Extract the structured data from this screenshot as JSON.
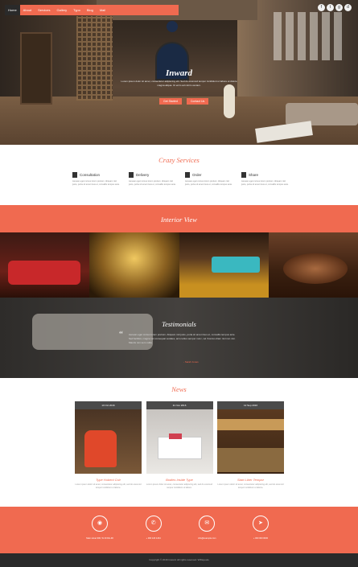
{
  "nav": {
    "items": [
      "Home",
      "About",
      "Services",
      "Gallery",
      "Typo",
      "Blog",
      "Mail"
    ],
    "active_index": 0
  },
  "social": [
    "facebook-icon",
    "twitter-icon",
    "google-plus-icon",
    "dribbble-icon"
  ],
  "hero": {
    "title": "Inward",
    "text": "Lorem ipsum dolor sit amet, consectetur adipiscing elit. Sed do eiusmod tempor incididunt ut labore et dolore magna aliqua. Ut enim ad minim veniam.",
    "btn_primary": "Get Started",
    "btn_secondary": "Contact Us"
  },
  "services": {
    "title": "Crazy Services",
    "items": [
      {
        "icon": "user-icon",
        "label": "Consultation",
        "text": "Aenean eget cursus lorem pretium. Aliquam nisl justo, porta sit amet risus et, convallis tempus ante."
      },
      {
        "icon": "bag-icon",
        "label": "Delivery",
        "text": "Aenean eget cursus lorem pretium. Aliquam nisl justo, porta sit amet risus et, convallis tempus ante."
      },
      {
        "icon": "document-icon",
        "label": "Order",
        "text": "Aenean eget cursus lorem pretium. Aliquam nisl justo, porta sit amet risus et, convallis tempus ante."
      },
      {
        "icon": "link-icon",
        "label": "Share",
        "text": "Aenean eget cursus lorem pretium. Aliquam nisl justo, porta sit amet risus et, convallis tempus ante."
      }
    ]
  },
  "interior": {
    "title": "Interior View"
  },
  "testimonials": {
    "title": "Testimonials",
    "text": "Aenean eget cursus lorem pretium. Aliquam nisl justo, porta sit amet risus et, convallis tempus ante. Sed facilisis, magna vel consequat sodales, arcu tellus semper nunc, vel rhoncus diam nisl non nisi. Mauris non sem nulla.",
    "name": "- Sarah Jones"
  },
  "news": {
    "title": "News",
    "cards": [
      {
        "date": "10 Oct 2016",
        "title": "Type Hubeni Coir",
        "text": "Lorem ipsum dolor sit amet, consectetur adipiscing elit, sed do eiusmod tempor incididunt ut labore."
      },
      {
        "date": "11 Nov 2016",
        "title": "Bodies Inside Type",
        "text": "Lorem ipsum dolor sit amet, consectetur adipiscing elit, sed do eiusmod tempor incididunt ut labore."
      },
      {
        "date": "12 Sep 2016",
        "title": "Start Liber Tempor",
        "text": "Lorem ipsum dolor sit amet, consectetur adipiscing elit, sed do eiusmod tempor incididunt ut labore."
      }
    ]
  },
  "contact": [
    {
      "icon": "location-icon",
      "glyph": "◉",
      "text": "Main street 900, W 40 DH-90"
    },
    {
      "icon": "phone-icon",
      "glyph": "✆",
      "text": "+ 000 120 1234"
    },
    {
      "icon": "mail-icon",
      "glyph": "✉",
      "text": "info@example.com"
    },
    {
      "icon": "send-icon",
      "glyph": "➤",
      "text": "+ 000 000 0000"
    }
  ],
  "footer": {
    "text": "Copyright © 2016 Inward. All rights reserved. W3layouts"
  },
  "colors": {
    "accent": "#f06a50",
    "dark": "#2a2a2a"
  }
}
